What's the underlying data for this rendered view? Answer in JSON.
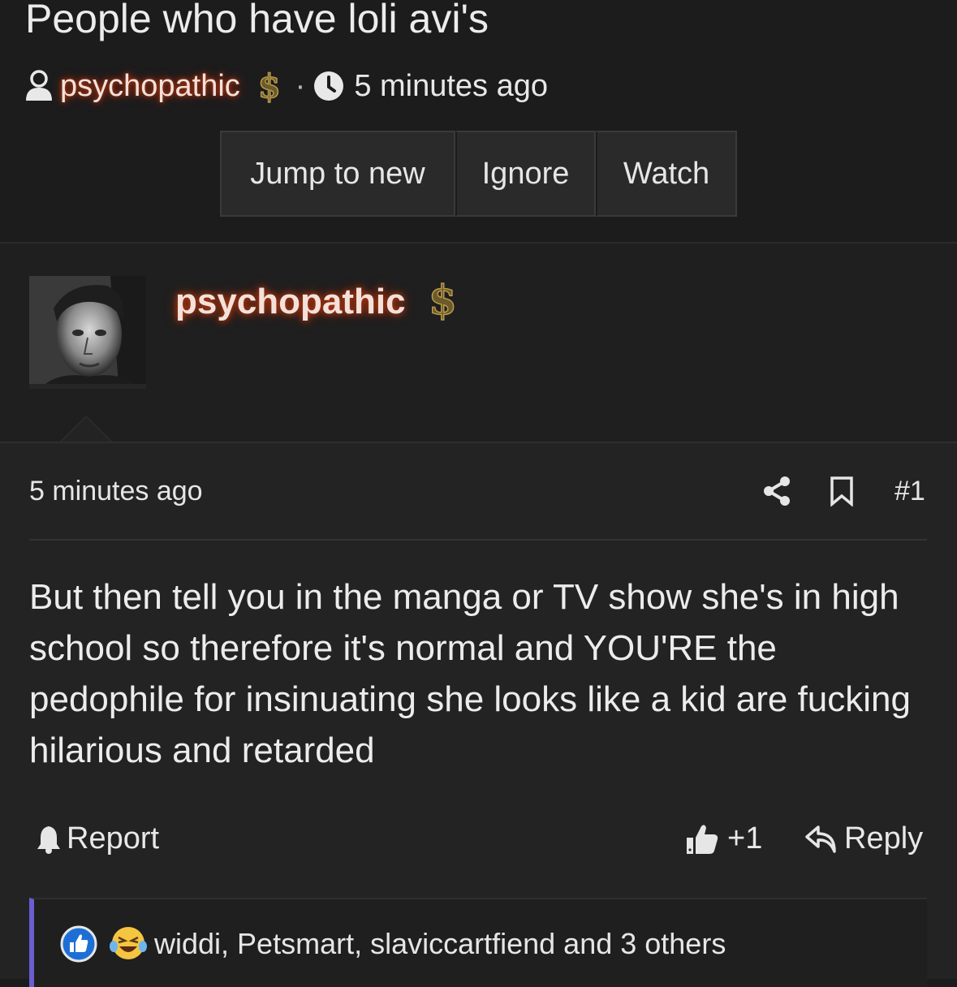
{
  "thread": {
    "title": "People who have loli avi's",
    "author": "psychopathic",
    "time": "5 minutes ago",
    "dollar": "$"
  },
  "buttons": {
    "jump_to_new": "Jump to new",
    "ignore": "Ignore",
    "watch": "Watch"
  },
  "post": {
    "username": "psychopathic",
    "dollar": "$",
    "time": "5 minutes ago",
    "number": "#1",
    "body": "But then tell you in the manga or TV show she's in high school so therefore it's normal and YOU'RE the pedophile for insinuating she looks like a kid are fucking hilarious and retarded",
    "report_label": "Report",
    "like_label": "+1",
    "reply_label": "Reply"
  },
  "reactions": {
    "names": "widdi, Petsmart, slaviccartfiend and 3 others"
  },
  "colors": {
    "background": "#1c1c1d",
    "post_background": "#232323",
    "username_glow": "#c43a10",
    "reactions_accent": "#6b5ed0"
  }
}
